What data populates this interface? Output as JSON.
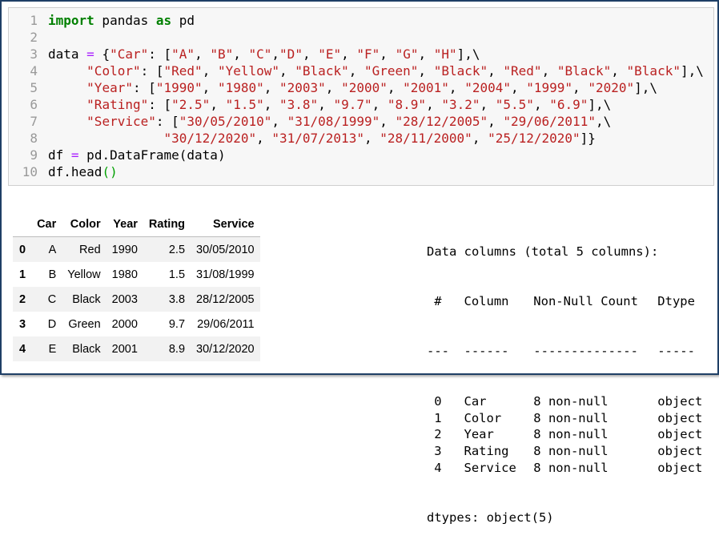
{
  "code": {
    "lines": [
      {
        "n": "1",
        "tokens": [
          {
            "t": "import",
            "c": "kw"
          },
          {
            "t": " pandas ",
            "c": ""
          },
          {
            "t": "as",
            "c": "kw"
          },
          {
            "t": " pd",
            "c": ""
          }
        ]
      },
      {
        "n": "2",
        "tokens": []
      },
      {
        "n": "3",
        "tokens": [
          {
            "t": "data ",
            "c": ""
          },
          {
            "t": "=",
            "c": "op"
          },
          {
            "t": " {",
            "c": ""
          },
          {
            "t": "\"Car\"",
            "c": "st"
          },
          {
            "t": ": [",
            "c": ""
          },
          {
            "t": "\"A\"",
            "c": "st"
          },
          {
            "t": ", ",
            "c": ""
          },
          {
            "t": "\"B\"",
            "c": "st"
          },
          {
            "t": ", ",
            "c": ""
          },
          {
            "t": "\"C\"",
            "c": "st"
          },
          {
            "t": ",",
            "c": ""
          },
          {
            "t": "\"D\"",
            "c": "st"
          },
          {
            "t": ", ",
            "c": ""
          },
          {
            "t": "\"E\"",
            "c": "st"
          },
          {
            "t": ", ",
            "c": ""
          },
          {
            "t": "\"F\"",
            "c": "st"
          },
          {
            "t": ", ",
            "c": ""
          },
          {
            "t": "\"G\"",
            "c": "st"
          },
          {
            "t": ", ",
            "c": ""
          },
          {
            "t": "\"H\"",
            "c": "st"
          },
          {
            "t": "],\\",
            "c": ""
          }
        ]
      },
      {
        "n": "4",
        "tokens": [
          {
            "t": "     ",
            "c": ""
          },
          {
            "t": "\"Color\"",
            "c": "st"
          },
          {
            "t": ": [",
            "c": ""
          },
          {
            "t": "\"Red\"",
            "c": "st"
          },
          {
            "t": ", ",
            "c": ""
          },
          {
            "t": "\"Yellow\"",
            "c": "st"
          },
          {
            "t": ", ",
            "c": ""
          },
          {
            "t": "\"Black\"",
            "c": "st"
          },
          {
            "t": ", ",
            "c": ""
          },
          {
            "t": "\"Green\"",
            "c": "st"
          },
          {
            "t": ", ",
            "c": ""
          },
          {
            "t": "\"Black\"",
            "c": "st"
          },
          {
            "t": ", ",
            "c": ""
          },
          {
            "t": "\"Red\"",
            "c": "st"
          },
          {
            "t": ", ",
            "c": ""
          },
          {
            "t": "\"Black\"",
            "c": "st"
          },
          {
            "t": ", ",
            "c": ""
          },
          {
            "t": "\"Black\"",
            "c": "st"
          },
          {
            "t": "],\\",
            "c": ""
          }
        ]
      },
      {
        "n": "5",
        "tokens": [
          {
            "t": "     ",
            "c": ""
          },
          {
            "t": "\"Year\"",
            "c": "st"
          },
          {
            "t": ": [",
            "c": ""
          },
          {
            "t": "\"1990\"",
            "c": "st"
          },
          {
            "t": ", ",
            "c": ""
          },
          {
            "t": "\"1980\"",
            "c": "st"
          },
          {
            "t": ", ",
            "c": ""
          },
          {
            "t": "\"2003\"",
            "c": "st"
          },
          {
            "t": ", ",
            "c": ""
          },
          {
            "t": "\"2000\"",
            "c": "st"
          },
          {
            "t": ", ",
            "c": ""
          },
          {
            "t": "\"2001\"",
            "c": "st"
          },
          {
            "t": ", ",
            "c": ""
          },
          {
            "t": "\"2004\"",
            "c": "st"
          },
          {
            "t": ", ",
            "c": ""
          },
          {
            "t": "\"1999\"",
            "c": "st"
          },
          {
            "t": ", ",
            "c": ""
          },
          {
            "t": "\"2020\"",
            "c": "st"
          },
          {
            "t": "],\\",
            "c": ""
          }
        ]
      },
      {
        "n": "6",
        "tokens": [
          {
            "t": "     ",
            "c": ""
          },
          {
            "t": "\"Rating\"",
            "c": "st"
          },
          {
            "t": ": [",
            "c": ""
          },
          {
            "t": "\"2.5\"",
            "c": "st"
          },
          {
            "t": ", ",
            "c": ""
          },
          {
            "t": "\"1.5\"",
            "c": "st"
          },
          {
            "t": ", ",
            "c": ""
          },
          {
            "t": "\"3.8\"",
            "c": "st"
          },
          {
            "t": ", ",
            "c": ""
          },
          {
            "t": "\"9.7\"",
            "c": "st"
          },
          {
            "t": ", ",
            "c": ""
          },
          {
            "t": "\"8.9\"",
            "c": "st"
          },
          {
            "t": ", ",
            "c": ""
          },
          {
            "t": "\"3.2\"",
            "c": "st"
          },
          {
            "t": ", ",
            "c": ""
          },
          {
            "t": "\"5.5\"",
            "c": "st"
          },
          {
            "t": ", ",
            "c": ""
          },
          {
            "t": "\"6.9\"",
            "c": "st"
          },
          {
            "t": "],\\",
            "c": ""
          }
        ]
      },
      {
        "n": "7",
        "tokens": [
          {
            "t": "     ",
            "c": ""
          },
          {
            "t": "\"Service\"",
            "c": "st"
          },
          {
            "t": ": [",
            "c": ""
          },
          {
            "t": "\"30/05/2010\"",
            "c": "st"
          },
          {
            "t": ", ",
            "c": ""
          },
          {
            "t": "\"31/08/1999\"",
            "c": "st"
          },
          {
            "t": ", ",
            "c": ""
          },
          {
            "t": "\"28/12/2005\"",
            "c": "st"
          },
          {
            "t": ", ",
            "c": ""
          },
          {
            "t": "\"29/06/2011\"",
            "c": "st"
          },
          {
            "t": ",\\",
            "c": ""
          }
        ]
      },
      {
        "n": "8",
        "tokens": [
          {
            "t": "               ",
            "c": ""
          },
          {
            "t": "\"30/12/2020\"",
            "c": "st"
          },
          {
            "t": ", ",
            "c": ""
          },
          {
            "t": "\"31/07/2013\"",
            "c": "st"
          },
          {
            "t": ", ",
            "c": ""
          },
          {
            "t": "\"28/11/2000\"",
            "c": "st"
          },
          {
            "t": ", ",
            "c": ""
          },
          {
            "t": "\"25/12/2020\"",
            "c": "st"
          },
          {
            "t": "]}",
            "c": ""
          }
        ]
      },
      {
        "n": "9",
        "tokens": [
          {
            "t": "df ",
            "c": ""
          },
          {
            "t": "=",
            "c": "op"
          },
          {
            "t": " pd.DataFrame(data)",
            "c": ""
          }
        ]
      },
      {
        "n": "10",
        "tokens": [
          {
            "t": "df.head",
            "c": ""
          },
          {
            "t": "()",
            "c": "br"
          }
        ]
      }
    ]
  },
  "dataframe": {
    "columns": [
      "",
      "Car",
      "Color",
      "Year",
      "Rating",
      "Service"
    ],
    "rows": [
      [
        "0",
        "A",
        "Red",
        "1990",
        "2.5",
        "30/05/2010"
      ],
      [
        "1",
        "B",
        "Yellow",
        "1980",
        "1.5",
        "31/08/1999"
      ],
      [
        "2",
        "C",
        "Black",
        "2003",
        "3.8",
        "28/12/2005"
      ],
      [
        "3",
        "D",
        "Green",
        "2000",
        "9.7",
        "29/06/2011"
      ],
      [
        "4",
        "E",
        "Black",
        "2001",
        "8.9",
        "30/12/2020"
      ]
    ]
  },
  "info": {
    "header": "Data columns (total 5 columns):",
    "col_headers": [
      "#",
      "Column",
      "Non-Null Count",
      "Dtype"
    ],
    "separators": [
      "---",
      "------",
      "--------------",
      "-----"
    ],
    "rows": [
      [
        "0",
        "Car",
        "8 non-null",
        "object"
      ],
      [
        "1",
        "Color",
        "8 non-null",
        "object"
      ],
      [
        "2",
        "Year",
        "8 non-null",
        "object"
      ],
      [
        "3",
        "Rating",
        "8 non-null",
        "object"
      ],
      [
        "4",
        "Service",
        "8 non-null",
        "object"
      ]
    ],
    "footer": "dtypes: object(5)"
  }
}
